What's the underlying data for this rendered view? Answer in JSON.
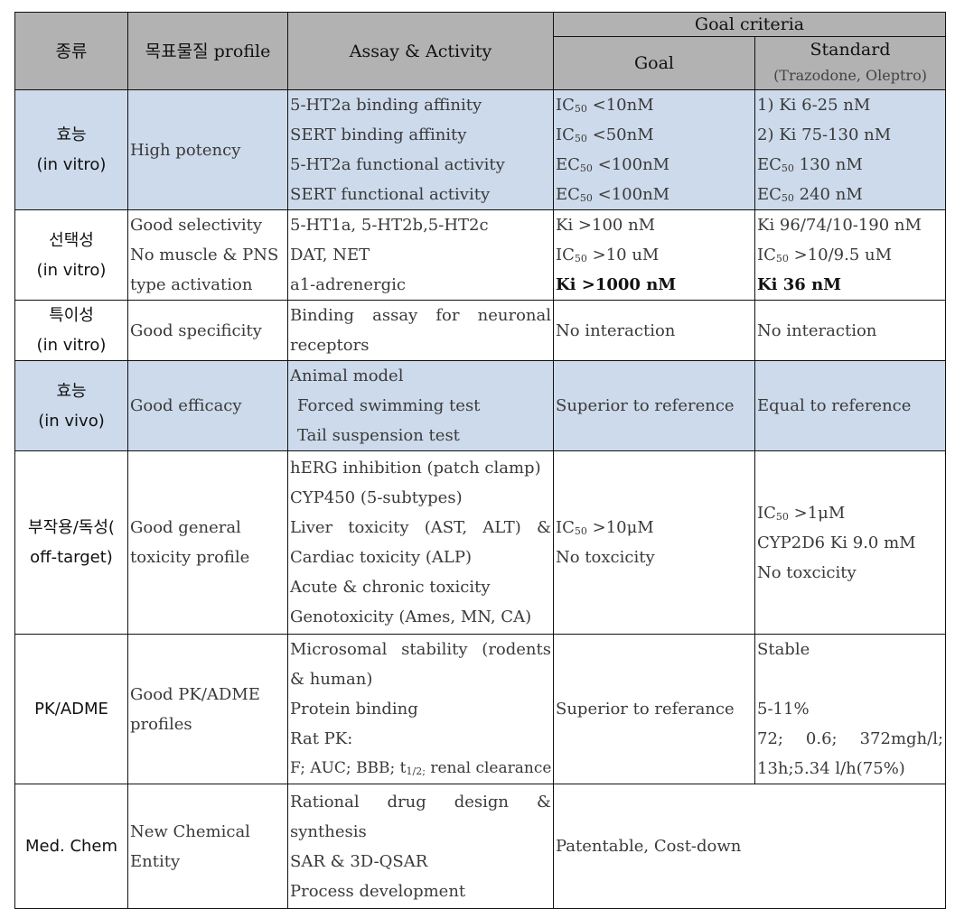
{
  "header": {
    "category": "종류",
    "profile": "목표물질 profile",
    "assay": "Assay & Activity",
    "goal_criteria": "Goal criteria",
    "goal": "Goal",
    "standard": "Standard",
    "standard_sub": "(Trazodone, Oleptro)"
  },
  "colors": {
    "header_bg": "#b2b2b2",
    "shaded_row_bg": "#ccdaeb",
    "border": "#111111"
  },
  "rows": [
    {
      "category": [
        "효능",
        "(in vitro)"
      ],
      "shaded": true,
      "profile": [
        "High potency"
      ],
      "assay": [
        "5-HT2a binding affinity",
        "SERT binding affinity",
        "5-HT2a functional activity",
        "SERT functional activity"
      ],
      "goal": [
        {
          "pre": "IC",
          "sub": "50",
          "post": " <10nM"
        },
        {
          "pre": "IC",
          "sub": "50",
          "post": " <50nM"
        },
        {
          "pre": "EC",
          "sub": "50",
          "post": " <100nM"
        },
        {
          "pre": "EC",
          "sub": "50",
          "post": " <100nM"
        }
      ],
      "standard": [
        {
          "pre": "1) Ki 6-25 nM"
        },
        {
          "pre": "2) Ki 75-130 nM"
        },
        {
          "pre": "EC",
          "sub": "50",
          "post": " 130 nM"
        },
        {
          "pre": "EC",
          "sub": "50",
          "post": " 240 nM"
        }
      ]
    },
    {
      "category": [
        "선택성",
        "(in vitro)"
      ],
      "shaded": false,
      "profile": [
        "Good selectivity",
        "No muscle & PNS",
        "type activation"
      ],
      "assay": [
        "5-HT1a, 5-HT2b,5-HT2c",
        "DAT, NET",
        "a1-adrenergic"
      ],
      "goal": [
        {
          "pre": "Ki >100 nM"
        },
        {
          "pre": "IC",
          "sub": "50",
          "post": " >10 uM"
        },
        {
          "pre": "Ki >1000 nM",
          "bold": true
        }
      ],
      "standard": [
        {
          "pre": "Ki 96/74/10-190 nM"
        },
        {
          "pre": "IC",
          "sub": "50",
          "post": " >10/9.5 uM"
        },
        {
          "pre": "Ki 36 nM",
          "bold": true
        }
      ]
    },
    {
      "category": [
        "특이성",
        "(in vitro)"
      ],
      "shaded": false,
      "profile": [
        "Good specificity"
      ],
      "assay": [
        "Binding assay for neuronal",
        "receptors"
      ],
      "goal": [
        {
          "pre": "No interaction"
        }
      ],
      "standard": [
        {
          "pre": "No interaction"
        }
      ]
    },
    {
      "category": [
        "효능",
        "(in vivo)"
      ],
      "shaded": true,
      "profile": [
        "Good efficacy"
      ],
      "assay": [
        "Animal model",
        "Forced swimming test",
        "Tail suspension test"
      ],
      "goal": [
        {
          "pre": "Superior to reference"
        }
      ],
      "standard": [
        {
          "pre": "Equal to reference"
        }
      ]
    },
    {
      "category": [
        "부작용/독성(",
        "off-target)"
      ],
      "shaded": false,
      "profile": [
        "Good general",
        "toxicity profile"
      ],
      "assay": [
        "hERG inhibition (patch clamp)",
        "CYP450 (5-subtypes)",
        "Liver toxicity (AST, ALT) &",
        "Cardiac toxicity (ALP)",
        "Acute & chronic toxicity",
        "Genotoxicity (Ames, MN, CA)"
      ],
      "goal": [
        {
          "pre": "IC",
          "sub": "50",
          "post": " >10μM"
        },
        {
          "pre": "No toxcicity"
        }
      ],
      "standard": [
        {
          "pre": "IC",
          "sub": "50",
          "post": " >1μM"
        },
        {
          "pre": "CYP2D6 Ki 9.0 mM"
        },
        {
          "pre": "No toxcicity"
        }
      ]
    },
    {
      "category": [
        "PK/ADME"
      ],
      "shaded": false,
      "profile": [
        "Good PK/ADME",
        "profiles"
      ],
      "assay": [
        "Microsomal stability (rodents",
        "& human)",
        "Protein binding",
        "Rat PK:",
        "F; AUC; BBB; t1/2; renal clearance"
      ],
      "goal": [
        {
          "pre": "Superior to referance"
        }
      ],
      "standard": [
        {
          "pre": "Stable"
        },
        {
          "pre": ""
        },
        {
          "pre": "5-11%"
        },
        {
          "pre": "72; 0.6; 372mgh/l;"
        },
        {
          "pre": "13h;5.34 l/h(75%)"
        }
      ]
    },
    {
      "category": [
        "Med. Chem"
      ],
      "shaded": false,
      "profile": [
        "New Chemical",
        "Entity"
      ],
      "assay": [
        "Rational drug design &",
        "synthesis",
        "SAR & 3D-QSAR",
        "Process development"
      ],
      "goal_merged": "Patentable, Cost-down"
    }
  ]
}
